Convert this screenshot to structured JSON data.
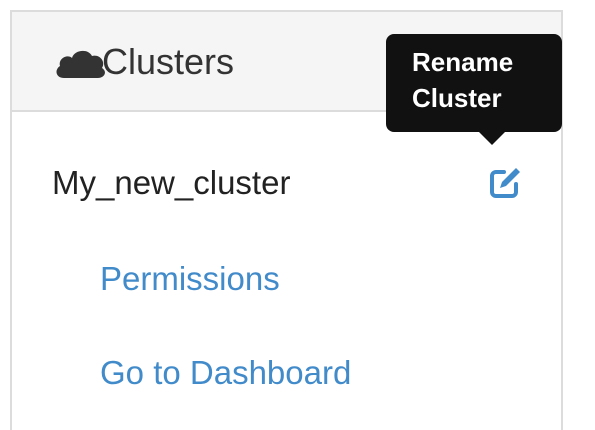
{
  "panel": {
    "header": {
      "title": "Clusters",
      "icon": "cloud-icon"
    },
    "cluster": {
      "name": "My_new_cluster",
      "edit_icon": "edit-icon"
    },
    "links": [
      {
        "label": "Permissions"
      },
      {
        "label": "Go to Dashboard"
      }
    ]
  },
  "tooltip": {
    "line1": "Rename",
    "line2": "Cluster"
  },
  "colors": {
    "link": "#428bca",
    "header_bg": "#f5f5f5",
    "border": "#dcdcdc",
    "tooltip_bg": "#111111"
  }
}
